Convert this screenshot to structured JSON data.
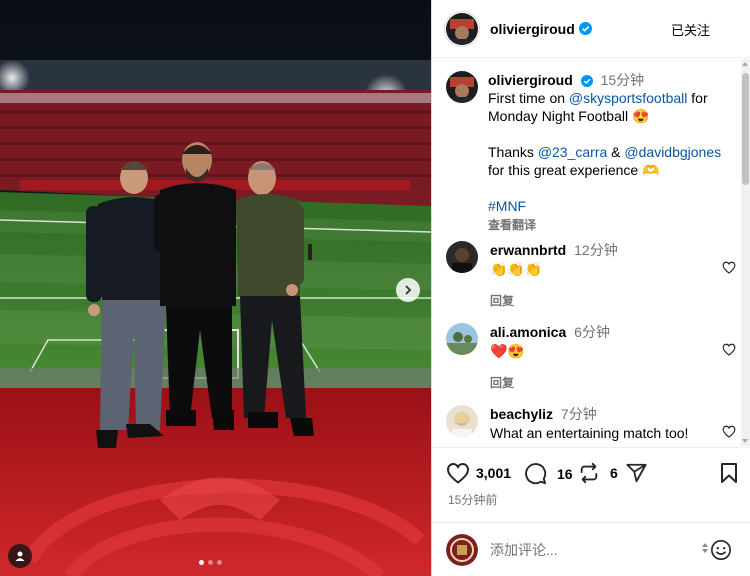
{
  "post": {
    "username": "oliviergiroud",
    "follow_label": "已关注",
    "caption": {
      "time": "15分钟",
      "line1_pre": "First time on ",
      "line1_mention": "@skysportsfootball",
      "line1_post": " for",
      "line2": "Monday Night Football",
      "line2_emoji": "😍",
      "thanks_pre": "Thanks ",
      "mention_a": "@23_carra",
      "amp": " & ",
      "mention_b": "@davidbgjones",
      "line4": "for this great experience",
      "line4_emoji": "🫶",
      "hashtag": "#MNF",
      "translate": "查看翻译"
    },
    "comments": [
      {
        "user": "erwannbrtd",
        "time": "12分钟",
        "text": "👏👏👏",
        "reply": "回复"
      },
      {
        "user": "ali.amonica",
        "time": "6分钟",
        "text": "❤️😍",
        "reply": "回复"
      },
      {
        "user": "beachyliz",
        "time": "7分钟",
        "text": "What an entertaining match too!",
        "reply": ""
      }
    ],
    "likes": "3,001",
    "comment_count": "16",
    "share_count": "6",
    "date": "15分钟前",
    "composer_placeholder": "添加评论..."
  },
  "carousel": {
    "slide_count": 3,
    "active": 1
  },
  "colors": {
    "link": "#0a56a6",
    "muted": "#737373",
    "verified": "#0095f6",
    "pitch": "#3d7a2c",
    "board_red": "#b3121a"
  },
  "icons": [
    "verified-icon",
    "chevron-right-icon",
    "heart-icon",
    "comment-icon",
    "repost-icon",
    "share-icon",
    "bookmark-icon",
    "emoji-icon",
    "user-tag-icon"
  ]
}
